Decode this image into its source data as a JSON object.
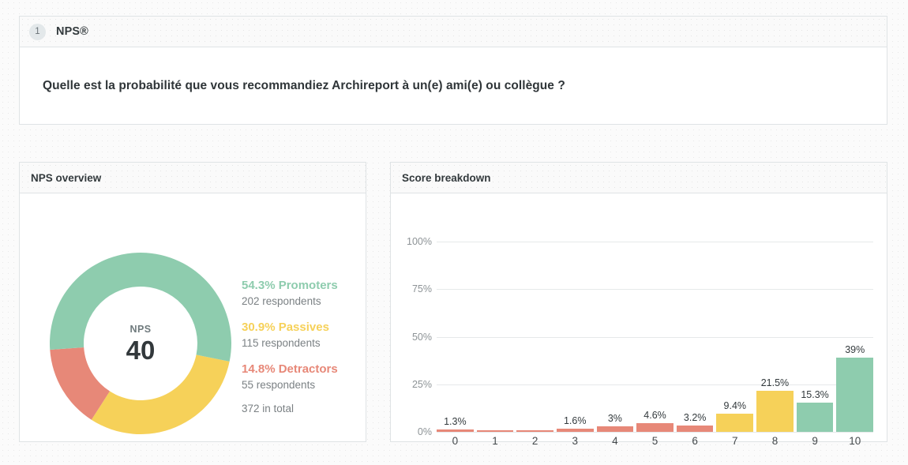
{
  "colors": {
    "promoter": "#8ECCAE",
    "passive": "#F6D159",
    "detractor": "#E78878",
    "panel_border": "#dfe3e5",
    "page_bg": "#fbfbfb",
    "text": "#333a3d",
    "muted": "#7b8184"
  },
  "question": {
    "number": "1",
    "type_label": "NPS®",
    "text": "Quelle est la probabilité que vous recommandiez Archireport à un(e) ami(e) ou collègue ?"
  },
  "nps_overview": {
    "title": "NPS overview",
    "donut": {
      "center_label": "NPS",
      "center_value": "40"
    },
    "legend": [
      {
        "percent": "54.3%",
        "name": "Promoters",
        "title": "54.3% Promoters",
        "respondents": "202 respondents",
        "color": "#8ECCAE"
      },
      {
        "percent": "30.9%",
        "name": "Passives",
        "title": "30.9% Passives",
        "respondents": "115 respondents",
        "color": "#F6D159"
      },
      {
        "percent": "14.8%",
        "name": "Detractors",
        "title": "14.8% Detractors",
        "respondents": "55 respondents",
        "color": "#E78878"
      }
    ],
    "total": "372 in total"
  },
  "score_breakdown": {
    "title": "Score breakdown"
  },
  "chart_data": [
    {
      "type": "pie",
      "title": "NPS overview",
      "subtype": "donut",
      "center_label": "NPS",
      "center_value": 40,
      "legend_position": "right",
      "categories": [
        "Promoters",
        "Passives",
        "Detractors"
      ],
      "values": [
        54.3,
        30.9,
        14.8
      ],
      "counts": [
        202,
        115,
        55
      ],
      "total": 372,
      "colors": [
        "#8ECCAE",
        "#F6D159",
        "#E78878"
      ]
    },
    {
      "type": "bar",
      "title": "Score breakdown",
      "xlabel": "",
      "ylabel": "",
      "categories": [
        "0",
        "1",
        "2",
        "3",
        "4",
        "5",
        "6",
        "7",
        "8",
        "9",
        "10"
      ],
      "values": [
        1.3,
        0.3,
        0.3,
        1.6,
        3,
        4.6,
        3.2,
        9.4,
        21.5,
        15.3,
        39
      ],
      "labels": [
        "1.3%",
        "",
        "",
        "1.6%",
        "3%",
        "4.6%",
        "3.2%",
        "9.4%",
        "21.5%",
        "15.3%",
        "39%"
      ],
      "bar_colors": [
        "#E78878",
        "#E78878",
        "#E78878",
        "#E78878",
        "#E78878",
        "#E78878",
        "#E78878",
        "#F6D159",
        "#F6D159",
        "#8ECCAE",
        "#8ECCAE"
      ],
      "ylim": [
        0,
        100
      ],
      "yticks": [
        0,
        25,
        50,
        75,
        100
      ],
      "ytick_labels": [
        "0%",
        "25%",
        "50%",
        "75%",
        "100%"
      ],
      "grid": true,
      "legend_position": "none"
    }
  ]
}
